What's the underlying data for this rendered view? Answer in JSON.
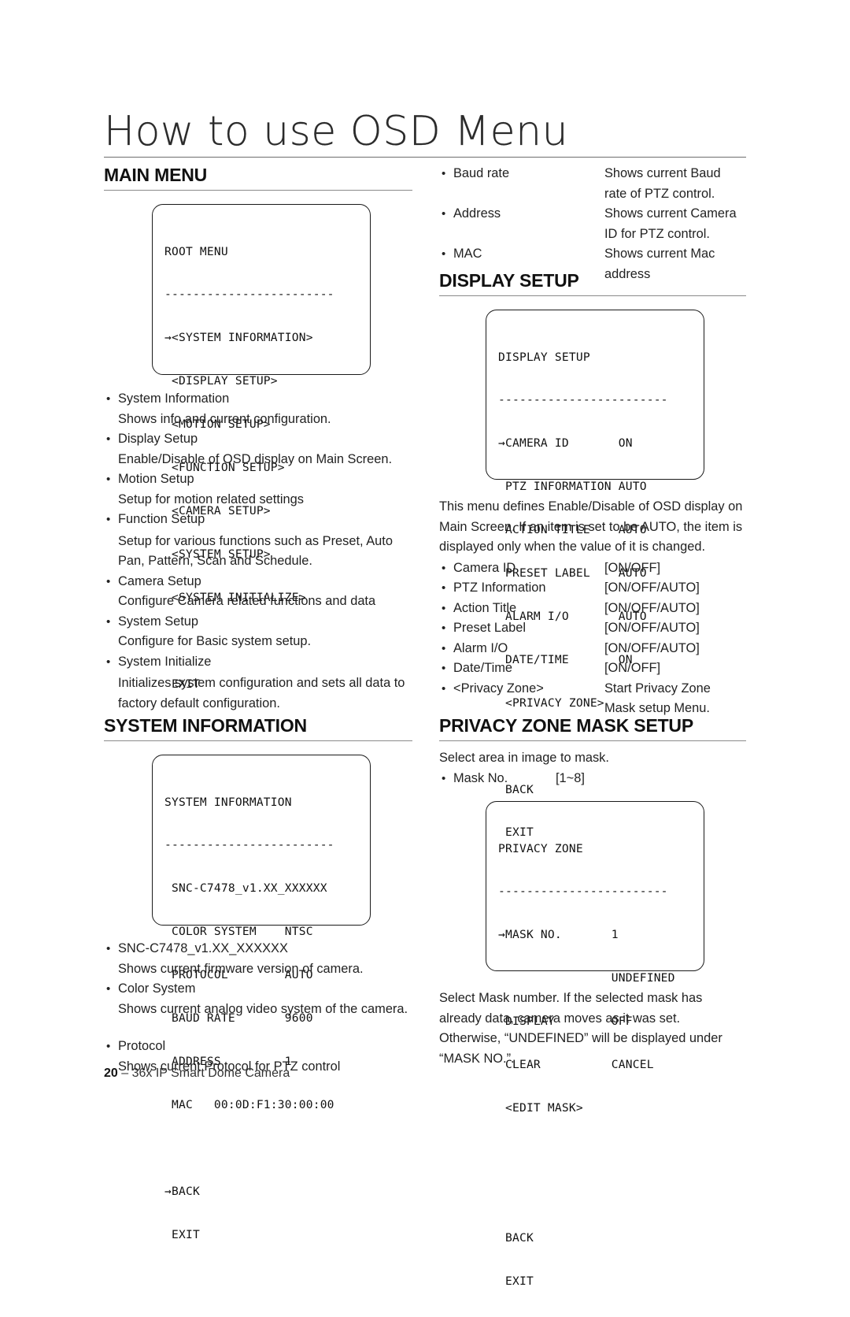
{
  "page": {
    "title": "How to use OSD Menu",
    "footer_page_number": "20",
    "footer_separator": " – ",
    "footer_text": "36x IP Smart Dome Camera"
  },
  "sections": {
    "main_menu": {
      "heading": "MAIN MENU",
      "osd": {
        "title": "ROOT MENU",
        "divider": "------------------------",
        "lines": [
          "→<SYSTEM INFORMATION>",
          " <DISPLAY SETUP>",
          " <MOTION SETUP>",
          " <FUNCTION SETUP>",
          " <CAMERA SETUP>",
          " <SYSTEM SETUP>",
          " <SYSTEM INITIALIZE>",
          "",
          " EXIT"
        ]
      },
      "items": [
        {
          "label": "System Information",
          "desc": "Shows info and current configuration."
        },
        {
          "label": "Display Setup",
          "desc": "Enable/Disable of OSD display on Main Screen."
        },
        {
          "label": "Motion Setup",
          "desc": "Setup for motion related settings"
        },
        {
          "label": "Function Setup",
          "desc": "Setup for various functions such as Preset, Auto Pan, Pattern, Scan and Schedule."
        },
        {
          "label": "Camera Setup",
          "desc": "Configure Camera related functions and data"
        },
        {
          "label": "System Setup",
          "desc": "Configure for Basic system setup."
        },
        {
          "label": "System Initialize",
          "desc": "Initializes system configuration and sets all data to factory default configuration."
        }
      ]
    },
    "system_information": {
      "heading": "SYSTEM INFORMATION",
      "osd": {
        "title": "SYSTEM INFORMATION",
        "divider": "------------------------",
        "lines": [
          " SNC-C7478_v1.XX_XXXXXX",
          " COLOR SYSTEM    NTSC",
          " PROTOCOL        AUTO",
          " BAUD RATE       9600",
          " ADDRESS         1",
          " MAC   00:0D:F1:30:00:00",
          "",
          "→BACK",
          " EXIT"
        ]
      },
      "items_left": [
        {
          "label": "SNC-C7478_v1.XX_XXXXXX",
          "desc": "Shows current firmware version of camera."
        },
        {
          "label": "Color System",
          "desc": "Shows current analog video system of the camera."
        },
        {
          "label": "Protocol",
          "desc": "Shows current Protocol for PTZ control"
        }
      ],
      "items_right": [
        {
          "label": "Baud rate",
          "value": "Shows current Baud rate of PTZ control."
        },
        {
          "label": "Address",
          "value": "Shows current Camera ID for PTZ control."
        },
        {
          "label": "MAC",
          "value": "Shows current Mac address"
        }
      ]
    },
    "display_setup": {
      "heading": "DISPLAY SETUP",
      "osd": {
        "title": "DISPLAY SETUP",
        "divider": "------------------------",
        "lines": [
          "→CAMERA ID       ON",
          " PTZ INFORMATION AUTO",
          " ACTION TITLE    AUTO",
          " PRESET LABEL    AUTO",
          " ALARM I/O       AUTO",
          " DATE/TIME       ON",
          " <PRIVACY ZONE>",
          "",
          " BACK",
          " EXIT"
        ]
      },
      "intro": "This menu defines Enable/Disable of OSD display on Main Screen. If an item is set to be AUTO, the item is displayed only when the value of it is changed.",
      "items": [
        {
          "label": "Camera ID",
          "value": "[ON/OFF]"
        },
        {
          "label": "PTZ Information",
          "value": "[ON/OFF/AUTO]"
        },
        {
          "label": "Action Title",
          "value": "[ON/OFF/AUTO]"
        },
        {
          "label": "Preset Label",
          "value": "[ON/OFF/AUTO]"
        },
        {
          "label": "Alarm I/O",
          "value": "[ON/OFF/AUTO]"
        },
        {
          "label": "Date/Time",
          "value": "[ON/OFF]"
        },
        {
          "label": "<Privacy Zone>",
          "value": "Start Privacy Zone Mask setup Menu."
        }
      ]
    },
    "privacy_zone_mask_setup": {
      "heading": "PRIVACY ZONE MASK SETUP",
      "intro": "Select area in image to mask.",
      "items": [
        {
          "label": "Mask No.",
          "value": "[1~8]"
        }
      ],
      "osd": {
        "title": "PRIVACY ZONE",
        "divider": "------------------------",
        "lines": [
          "→MASK NO.       1",
          "                UNDEFINED",
          " DISPLAY        OFF",
          " CLEAR          CANCEL",
          " <EDIT MASK>",
          "",
          "",
          " BACK",
          " EXIT"
        ]
      },
      "outro": "Select Mask number. If the selected mask has already data, camera moves as it was set.\nOtherwise, “UNDEFINED” will be displayed under “MASK NO.”."
    }
  }
}
